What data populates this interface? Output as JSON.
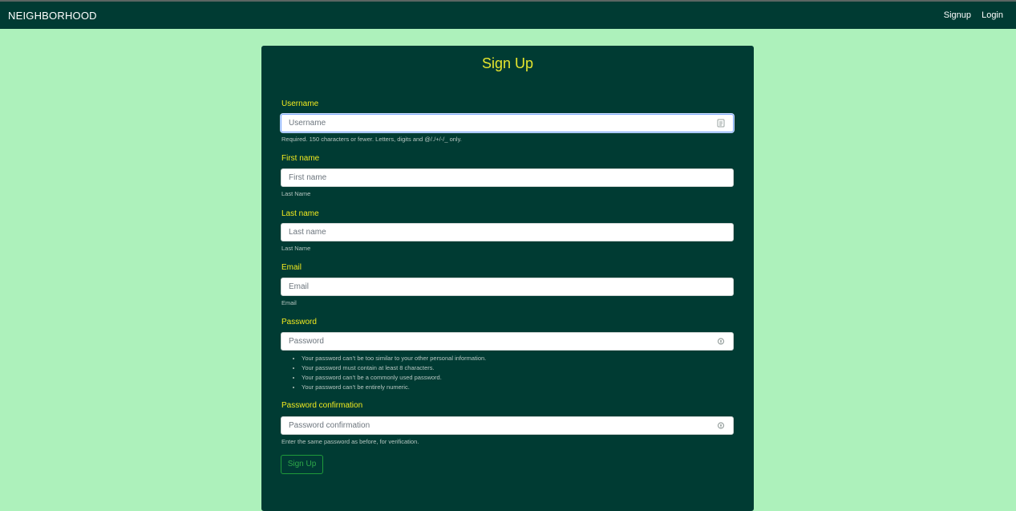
{
  "navbar": {
    "brand": "NEIGHBORHOOD",
    "links": [
      "Signup",
      "Login"
    ]
  },
  "form": {
    "title": "Sign Up",
    "fields": [
      {
        "label": "Username",
        "placeholder": "Username",
        "help": "Required. 150 characters or fewer. Letters, digits and @/./+/-/_ only.",
        "icon": "contact-card-icon"
      },
      {
        "label": "First name",
        "placeholder": "First name",
        "help": "Last Name"
      },
      {
        "label": "Last name",
        "placeholder": "Last name",
        "help": "Last Name"
      },
      {
        "label": "Email",
        "placeholder": "Email",
        "help": "Email"
      },
      {
        "label": "Password",
        "placeholder": "Password",
        "icon": "key-icon",
        "help_list": [
          "Your password can’t be too similar to your other personal information.",
          "Your password must contain at least 8 characters.",
          "Your password can’t be a commonly used password.",
          "Your password can’t be entirely numeric."
        ]
      },
      {
        "label": "Password confirmation",
        "placeholder": "Password confirmation",
        "help": "Enter the same password as before, for verification.",
        "icon": "key-icon"
      }
    ],
    "submit_label": "Sign Up"
  },
  "colors": {
    "page_background": "#adf1bb",
    "navbar_background": "#003b33",
    "card_background": "#003b33",
    "label_color": "#f2ea1f",
    "button_accent": "#2ea84a"
  }
}
